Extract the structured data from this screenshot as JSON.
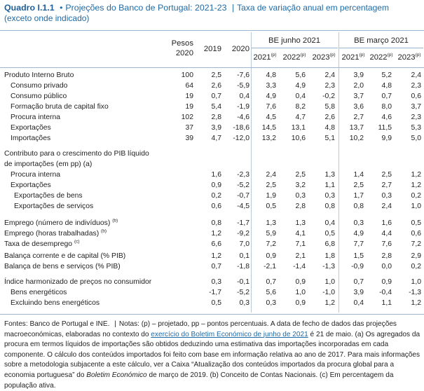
{
  "title": {
    "box_label": "Quadro I.1.1",
    "bullet": "•",
    "main": "Projeções do Banco de Portugal: 2021-23",
    "sep": "|",
    "unit": "Taxa de variação anual em percentagem",
    "unit_note": "(exceto onde indicado)"
  },
  "header": {
    "weights_line1": "Pesos",
    "weights_line2": "2020",
    "y2019": "2019",
    "y2020": "2020",
    "group_june": "BE junho 2021",
    "group_march": "BE março 2021",
    "proj_years": [
      "2021",
      "2022",
      "2023"
    ],
    "proj_marker": "(p)"
  },
  "rows": [
    {
      "label": "Produto Interno Bruto",
      "sup": "",
      "indent": 0,
      "w": "100",
      "y19": "2,5",
      "y20": "-7,6",
      "j21": "4,8",
      "j22": "5,6",
      "j23": "2,4",
      "m21": "3,9",
      "m22": "5,2",
      "m23": "2,4"
    },
    {
      "label": "Consumo privado",
      "sup": "",
      "indent": 1,
      "w": "64",
      "y19": "2,6",
      "y20": "-5,9",
      "j21": "3,3",
      "j22": "4,9",
      "j23": "2,3",
      "m21": "2,0",
      "m22": "4,8",
      "m23": "2,3"
    },
    {
      "label": "Consumo público",
      "sup": "",
      "indent": 1,
      "w": "19",
      "y19": "0,7",
      "y20": "0,4",
      "j21": "4,9",
      "j22": "0,4",
      "j23": "-0,2",
      "m21": "3,7",
      "m22": "0,7",
      "m23": "0,6"
    },
    {
      "label": "Formação bruta de capital fixo",
      "sup": "",
      "indent": 1,
      "w": "19",
      "y19": "5,4",
      "y20": "-1,9",
      "j21": "7,6",
      "j22": "8,2",
      "j23": "5,8",
      "m21": "3,6",
      "m22": "8,0",
      "m23": "3,7"
    },
    {
      "label": "Procura interna",
      "sup": "",
      "indent": 1,
      "w": "102",
      "y19": "2,8",
      "y20": "-4,6",
      "j21": "4,5",
      "j22": "4,7",
      "j23": "2,6",
      "m21": "2,7",
      "m22": "4,6",
      "m23": "2,3"
    },
    {
      "label": "Exportações",
      "sup": "",
      "indent": 1,
      "w": "37",
      "y19": "3,9",
      "y20": "-18,6",
      "j21": "14,5",
      "j22": "13,1",
      "j23": "4,8",
      "m21": "13,7",
      "m22": "11,5",
      "m23": "5,3"
    },
    {
      "label": "Importações",
      "sup": "",
      "indent": 1,
      "w": "39",
      "y19": "4,7",
      "y20": "-12,0",
      "j21": "13,2",
      "j22": "10,6",
      "j23": "5,1",
      "m21": "10,2",
      "m22": "9,9",
      "m23": "5,0"
    },
    {
      "label": "Contributo para o crescimento do PIB líquido",
      "sup": "",
      "indent": 0,
      "w": "",
      "y19": "",
      "y20": "",
      "j21": "",
      "j22": "",
      "j23": "",
      "m21": "",
      "m22": "",
      "m23": ""
    },
    {
      "label": "de importações (em pp) (a)",
      "sup": "",
      "indent": 0,
      "w": "",
      "y19": "",
      "y20": "",
      "j21": "",
      "j22": "",
      "j23": "",
      "m21": "",
      "m22": "",
      "m23": ""
    },
    {
      "label": "Procura interna",
      "sup": "",
      "indent": 1,
      "w": "",
      "y19": "1,6",
      "y20": "-2,3",
      "j21": "2,4",
      "j22": "2,5",
      "j23": "1,3",
      "m21": "1,4",
      "m22": "2,5",
      "m23": "1,2"
    },
    {
      "label": "Exportações",
      "sup": "",
      "indent": 1,
      "w": "",
      "y19": "0,9",
      "y20": "-5,2",
      "j21": "2,5",
      "j22": "3,2",
      "j23": "1,1",
      "m21": "2,5",
      "m22": "2,7",
      "m23": "1,2"
    },
    {
      "label": "Exportações de bens",
      "sup": "",
      "indent": 2,
      "w": "",
      "y19": "0,2",
      "y20": "-0,7",
      "j21": "1,9",
      "j22": "0,3",
      "j23": "0,3",
      "m21": "1,7",
      "m22": "0,3",
      "m23": "0,2"
    },
    {
      "label": "Exportações de serviços",
      "sup": "",
      "indent": 2,
      "w": "",
      "y19": "0,6",
      "y20": "-4,5",
      "j21": "0,5",
      "j22": "2,8",
      "j23": "0,8",
      "m21": "0,8",
      "m22": "2,4",
      "m23": "1,0"
    },
    {
      "label": "Emprego (número de indivíduos)",
      "sup": "(b)",
      "indent": 0,
      "w": "",
      "y19": "0,8",
      "y20": "-1,7",
      "j21": "1,3",
      "j22": "1,3",
      "j23": "0,4",
      "m21": "0,3",
      "m22": "1,6",
      "m23": "0,5"
    },
    {
      "label": "Emprego (horas trabalhadas)",
      "sup": "(b)",
      "indent": 0,
      "w": "",
      "y19": "1,2",
      "y20": "-9,2",
      "j21": "5,9",
      "j22": "4,1",
      "j23": "0,5",
      "m21": "4,9",
      "m22": "4,4",
      "m23": "0,6"
    },
    {
      "label": "Taxa de desemprego",
      "sup": "(c)",
      "indent": 0,
      "w": "",
      "y19": "6,6",
      "y20": "7,0",
      "j21": "7,2",
      "j22": "7,1",
      "j23": "6,8",
      "m21": "7,7",
      "m22": "7,6",
      "m23": "7,2"
    },
    {
      "label": "Balança corrente e de capital (% PIB)",
      "sup": "",
      "indent": 0,
      "w": "",
      "y19": "1,2",
      "y20": "0,1",
      "j21": "0,9",
      "j22": "2,1",
      "j23": "1,8",
      "m21": "1,5",
      "m22": "2,8",
      "m23": "2,9"
    },
    {
      "label": "Balança de bens e serviços (% PIB)",
      "sup": "",
      "indent": 0,
      "w": "",
      "y19": "0,7",
      "y20": "-1,8",
      "j21": "-2,1",
      "j22": "-1,4",
      "j23": "-1,3",
      "m21": "-0,9",
      "m22": "0,0",
      "m23": "0,2"
    },
    {
      "label": "Índice harmonizado de preços no consumidor",
      "sup": "",
      "indent": 0,
      "w": "",
      "y19": "0,3",
      "y20": "-0,1",
      "j21": "0,7",
      "j22": "0,9",
      "j23": "1,0",
      "m21": "0,7",
      "m22": "0,9",
      "m23": "1,0"
    },
    {
      "label": "Bens energéticos",
      "sup": "",
      "indent": 1,
      "w": "",
      "y19": "-1,7",
      "y20": "-5,2",
      "j21": "5,6",
      "j22": "1,0",
      "j23": "-1,0",
      "m21": "3,9",
      "m22": "-0,4",
      "m23": "-1,3"
    },
    {
      "label": "Excluindo bens energéticos",
      "sup": "",
      "indent": 1,
      "w": "",
      "y19": "0,5",
      "y20": "0,3",
      "j21": "0,3",
      "j22": "0,9",
      "j23": "1,2",
      "m21": "0,4",
      "m22": "1,1",
      "m23": "1,2"
    }
  ],
  "footer": {
    "sources": "Fontes: Banco de Portugal e INE.",
    "sep": "|",
    "notes_a": "Notas: (p) – projetado, pp – pontos percentuais. A data de fecho de dados das projeções macroeconómicas, elaboradas no contexto do ",
    "link": "exercício do Boletim Económico de junho de 2021",
    "notes_b": " é 21 de maio. (a) Os agregados da procura em termos líquidos de importações são obtidos deduzindo uma estimativa das importações incorporadas em cada componente. O cálculo dos conteúdos importados foi feito com base em informação relativa ao ano de 2017. Para mais informações sobre a metodologia subjacente a este cálculo, ver a Caixa “Atualização dos conteúdos importados da procura global para a economia portuguesa” do ",
    "boletim": "Boletim Económico",
    "notes_c": " de março de 2019. (b) Conceito de Contas Nacionais. (c) Em percentagem da população ativa."
  }
}
